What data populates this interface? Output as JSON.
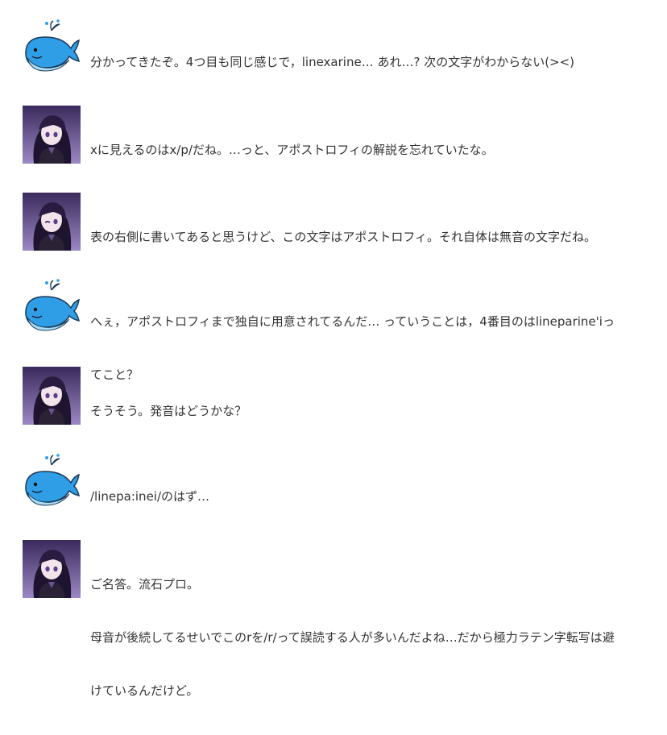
{
  "messages": [
    {
      "speaker": "whale",
      "icon": "whale-icon",
      "lines": [
        "分かってきたぞ。4つ目も同じ感じで，linexarine… あれ…? 次の文字がわからない(><)"
      ]
    },
    {
      "speaker": "girl",
      "icon": "girl-avatar",
      "lines": [
        "xに見えるのはx/p/だね。…っと、アポストロフィの解説を忘れていたな。"
      ]
    },
    {
      "speaker": "girl",
      "icon": "girl-avatar",
      "lines": [
        "表の右側に書いてあると思うけど、この文字はアポストロフィ。それ自体は無音の文字だね。"
      ]
    },
    {
      "speaker": "whale",
      "icon": "whale-icon",
      "lines": [
        "へぇ，アポストロフィまで独自に用意されてるんだ… っていうことは，4番目のはlineparine'iっ",
        "てこと？"
      ]
    },
    {
      "speaker": "girl",
      "icon": "girl-avatar",
      "lines": [
        "そうそう。発音はどうかな？"
      ]
    },
    {
      "speaker": "whale",
      "icon": "whale-icon",
      "lines": [
        "/linepa:inei/のはず…"
      ]
    },
    {
      "speaker": "girl",
      "icon": "girl-avatar",
      "lines": [
        "ご名答。流石プロ。",
        "母音が後続してるせいでこのrを/r/って誤読する人が多いんだよね…だから極力ラテン字転写は避",
        "けているんだけど。"
      ]
    }
  ],
  "colors": {
    "whale_body": "#2f9ee6",
    "whale_belly": "#a9dcf5",
    "girl_bg_top": "#3b2a5c",
    "girl_bg_bottom": "#9b88c4",
    "text": "#333333"
  }
}
